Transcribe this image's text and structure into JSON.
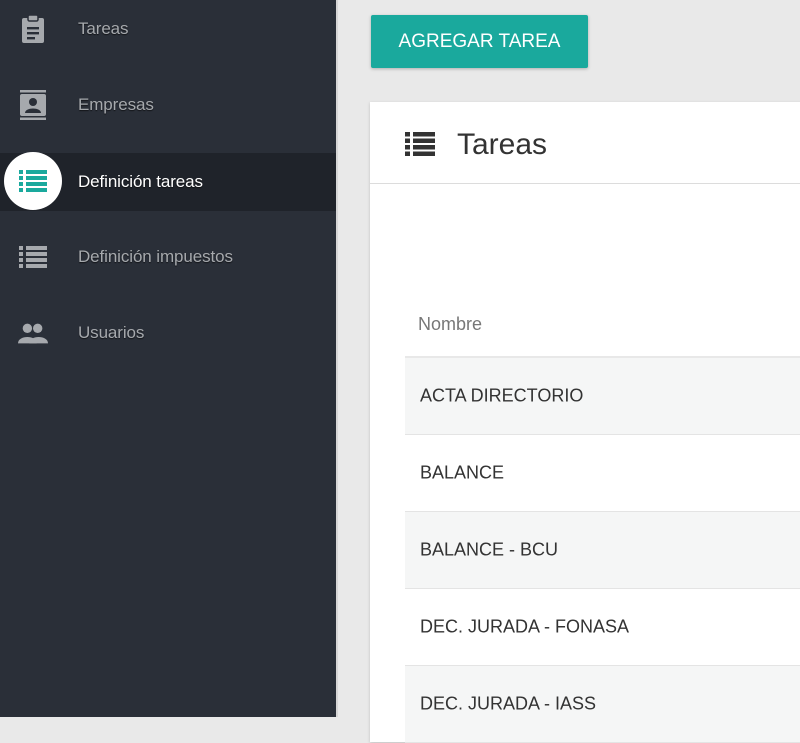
{
  "sidebar": {
    "items": [
      {
        "label": "Tareas",
        "icon": "clipboard-icon",
        "active": false
      },
      {
        "label": "Empresas",
        "icon": "contact-book-icon",
        "active": false
      },
      {
        "label": "Definición tareas",
        "icon": "list-icon",
        "active": true
      },
      {
        "label": "Definición impuestos",
        "icon": "list-icon",
        "active": false
      },
      {
        "label": "Usuarios",
        "icon": "people-icon",
        "active": false
      }
    ]
  },
  "toolbar": {
    "add_task_label": "AGREGAR TAREA"
  },
  "card": {
    "title": "Tareas",
    "icon": "list-icon",
    "table": {
      "header": "Nombre",
      "rows": [
        "ACTA DIRECTORIO",
        "BALANCE",
        "BALANCE - BCU",
        "DEC. JURADA - FONASA",
        "DEC. JURADA - IASS"
      ]
    }
  },
  "colors": {
    "accent": "#1aa99d",
    "sidebar_bg": "#2a2f38",
    "sidebar_active_bg": "#1f232a",
    "sidebar_text": "#a6a9ad"
  }
}
